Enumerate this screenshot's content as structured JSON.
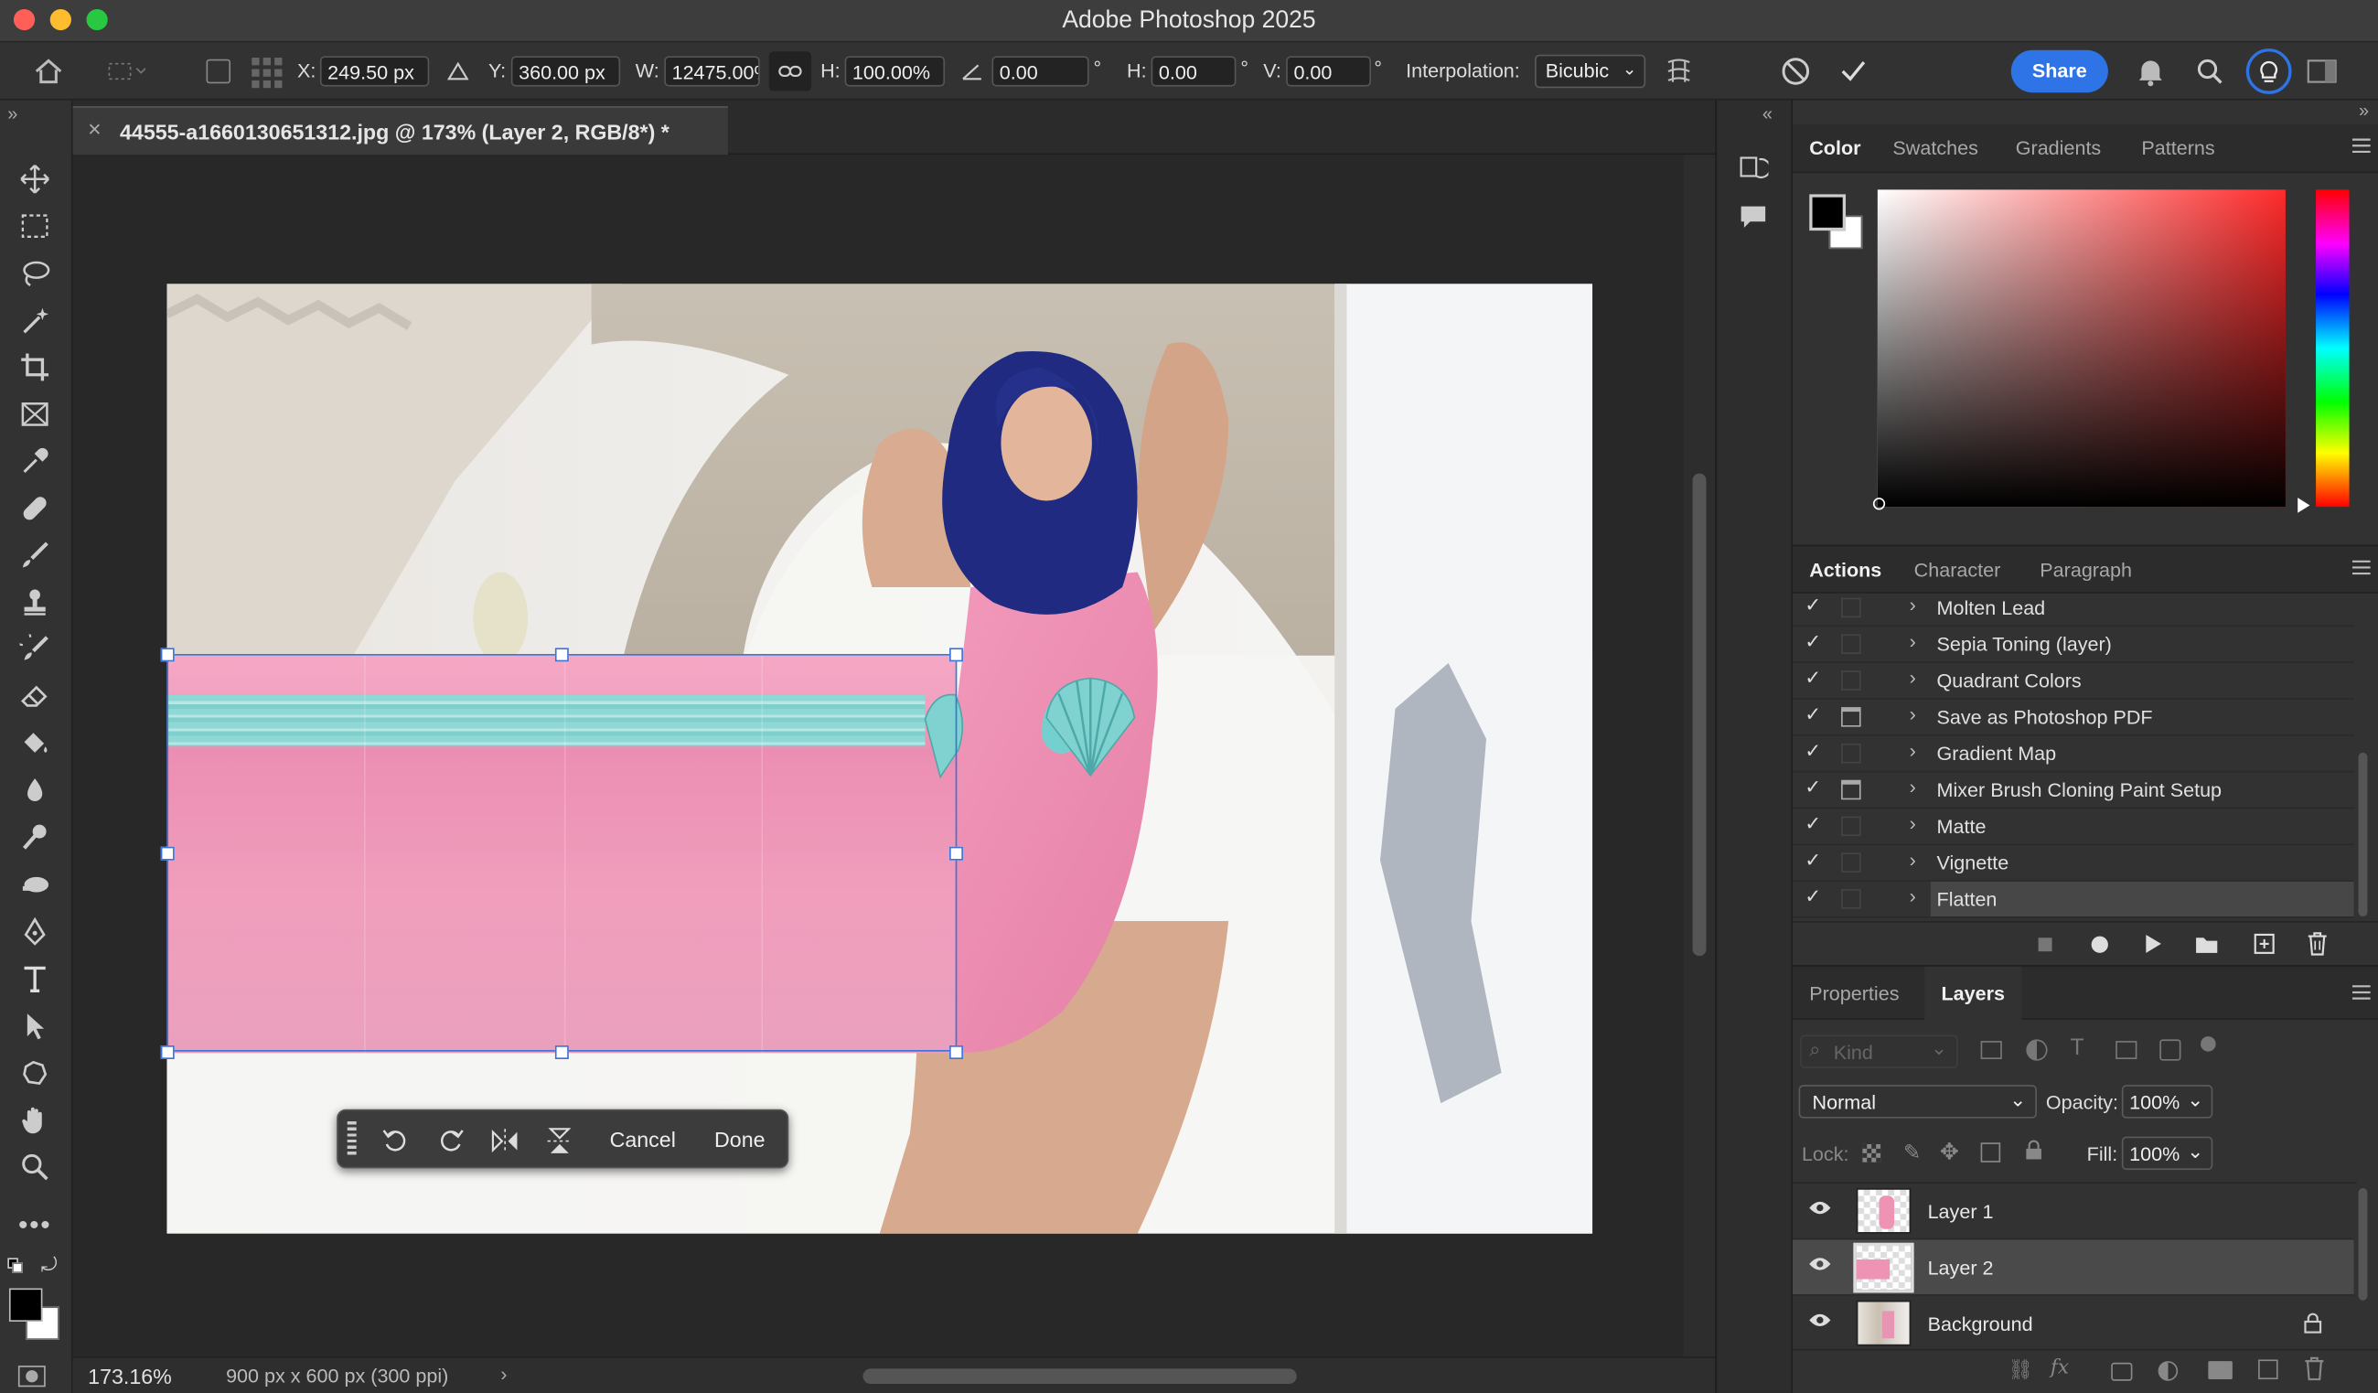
{
  "app": {
    "title": "Adobe Photoshop 2025"
  },
  "options": {
    "x_label": "X:",
    "x_value": "249.50 px",
    "y_label": "Y:",
    "y_value": "360.00 px",
    "w_label": "W:",
    "w_value": "12475.00%",
    "h_label": "H:",
    "h_value": "100.00%",
    "angle_value": "0.00",
    "deg": "°",
    "hskew_label": "H:",
    "hskew_value": "0.00",
    "vskew_label": "V:",
    "vskew_value": "0.00",
    "interp_label": "Interpolation:",
    "interp_value": "Bicubic",
    "share_label": "Share"
  },
  "document": {
    "tab_title": "44555-a1660130651312.jpg @ 173% (Layer 2, RGB/8*) *",
    "close": "×"
  },
  "status": {
    "zoom": "173.16%",
    "info": "900 px x 600 px (300 ppi)"
  },
  "context_bar": {
    "cancel": "Cancel",
    "done": "Done"
  },
  "color_panel": {
    "tabs": [
      "Color",
      "Swatches",
      "Gradients",
      "Patterns"
    ]
  },
  "actions_panel": {
    "tabs": [
      "Actions",
      "Character",
      "Paragraph"
    ],
    "items": [
      {
        "label": "Molten Lead",
        "dialog": false
      },
      {
        "label": "Sepia Toning (layer)",
        "dialog": false
      },
      {
        "label": "Quadrant Colors",
        "dialog": false
      },
      {
        "label": "Save as Photoshop PDF",
        "dialog": true
      },
      {
        "label": "Gradient Map",
        "dialog": false
      },
      {
        "label": "Mixer Brush Cloning Paint Setup",
        "dialog": true
      },
      {
        "label": "Matte",
        "dialog": false
      },
      {
        "label": "Vignette",
        "dialog": false
      },
      {
        "label": "Flatten",
        "dialog": false
      }
    ]
  },
  "layers_panel": {
    "tabs": [
      "Properties",
      "Layers"
    ],
    "kind_placeholder": "Kind",
    "blend_mode": "Normal",
    "opacity_label": "Opacity:",
    "opacity_value": "100%",
    "lock_label": "Lock:",
    "fill_label": "Fill:",
    "fill_value": "100%",
    "layers": [
      {
        "name": "Layer 1",
        "selected": false,
        "locked": false
      },
      {
        "name": "Layer 2",
        "selected": true,
        "locked": false
      },
      {
        "name": "Background",
        "selected": false,
        "locked": true
      }
    ]
  },
  "colors": {
    "accent": "#2e74e6",
    "selection": "#3c73d8",
    "pink": "#ef94b6",
    "teal": "#8fd8d6"
  }
}
